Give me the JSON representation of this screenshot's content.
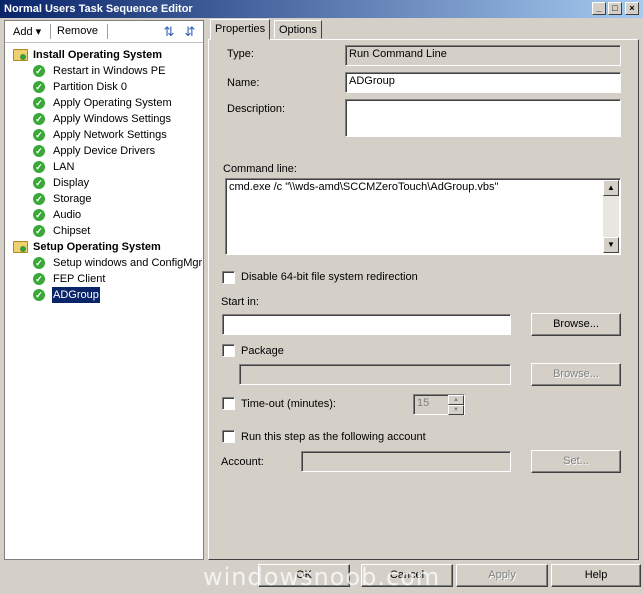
{
  "window": {
    "title": "Normal Users Task Sequence Editor"
  },
  "toolbar": {
    "add_label": "Add",
    "remove_label": "Remove"
  },
  "tree": {
    "groups": [
      {
        "label": "Install Operating System"
      },
      {
        "label": "Setup Operating System"
      }
    ],
    "items": [
      {
        "label": "Restart in Windows PE"
      },
      {
        "label": "Partition Disk 0"
      },
      {
        "label": "Apply Operating System"
      },
      {
        "label": "Apply Windows Settings"
      },
      {
        "label": "Apply Network Settings"
      },
      {
        "label": "Apply Device Drivers"
      },
      {
        "label": "LAN"
      },
      {
        "label": "Display"
      },
      {
        "label": "Storage"
      },
      {
        "label": "Audio"
      },
      {
        "label": "Chipset"
      },
      {
        "label": "Setup windows and ConfigMgr"
      },
      {
        "label": "FEP Client"
      },
      {
        "label": "ADGroup"
      }
    ]
  },
  "tabs": [
    {
      "label": "Properties"
    },
    {
      "label": "Options"
    }
  ],
  "properties": {
    "type_label": "Type:",
    "type_value": "Run Command Line",
    "name_label": "Name:",
    "name_value": "ADGroup",
    "description_label": "Description:",
    "description_value": "",
    "command_line_label": "Command line:",
    "command_line_value": "cmd.exe /c \"\\\\wds-amd\\SCCMZeroTouch\\AdGroup.vbs\"",
    "disable_redirection_label": "Disable 64-bit file system redirection",
    "start_in_label": "Start in:",
    "start_in_value": "",
    "browse_label": "Browse...",
    "package_label": "Package",
    "package_value": "",
    "package_browse_label": "Browse...",
    "timeout_label": "Time-out (minutes):",
    "timeout_value": "15",
    "run_as_label": "Run this step as the following account",
    "account_label": "Account:",
    "account_value": "",
    "set_label": "Set..."
  },
  "buttons": {
    "ok": "OK",
    "cancel": "Cancel",
    "apply": "Apply",
    "help": "Help"
  },
  "watermark": "windowsnoob.com"
}
